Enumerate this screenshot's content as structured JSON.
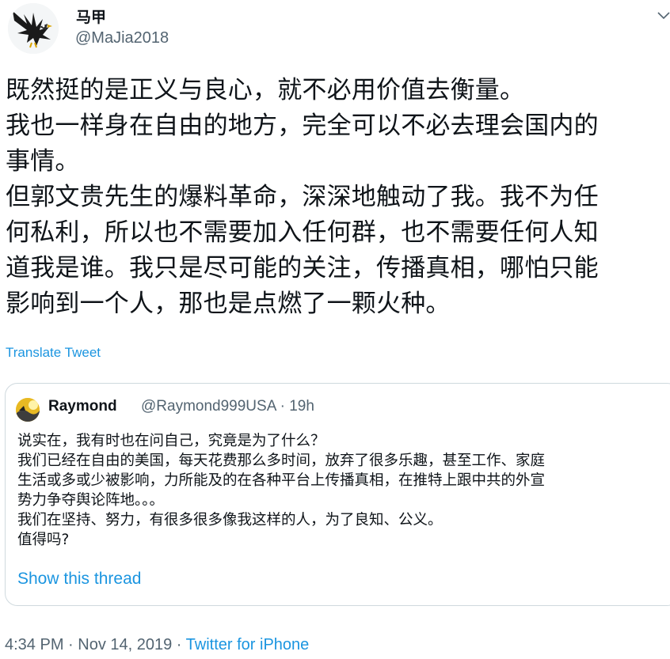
{
  "author": {
    "display_name": "马甲",
    "handle": "@MaJia2018",
    "avatar_icon": "eagle-avatar-icon"
  },
  "tweet": {
    "lines": [
      "既然挺的是正义与良心，就不必用价值去衡量。",
      "我也一样身在自由的地方，完全可以不必去理会国内的",
      "事情。",
      "但郭文贵先生的爆料革命，深深地触动了我。我不为任",
      "何私利，所以也不需要加入任何群，也不需要任何人知",
      "道我是谁。我只是尽可能的关注，传播真相，哪怕只能",
      "影响到一个人，那也是点燃了一颗火种。"
    ],
    "translate_label": "Translate Tweet"
  },
  "quoted_tweet": {
    "display_name": "Raymond",
    "meta": "@Raymond999USA · 19h",
    "lines": [
      "说实在，我有时也在问自己，究竟是为了什么？",
      "我们已经在自由的美国，每天花费那么多时间，放弃了很多乐趣，甚至工作、家庭",
      "生活或多或少被影响，力所能及的在各种平台上传播真相，在推特上跟中共的外宣",
      "势力争夺舆论阵地。。。",
      "我们在坚持、努力，有很多很多像我这样的人，为了良知、公义。",
      "值得吗?"
    ],
    "show_thread_label": "Show this thread"
  },
  "footer": {
    "timestamp": "4:34 PM · Nov 14, 2019 · ",
    "source": "Twitter for iPhone"
  },
  "colors": {
    "link": "#1b95e0",
    "secondary_text": "#536471",
    "border": "#cfd9de"
  }
}
